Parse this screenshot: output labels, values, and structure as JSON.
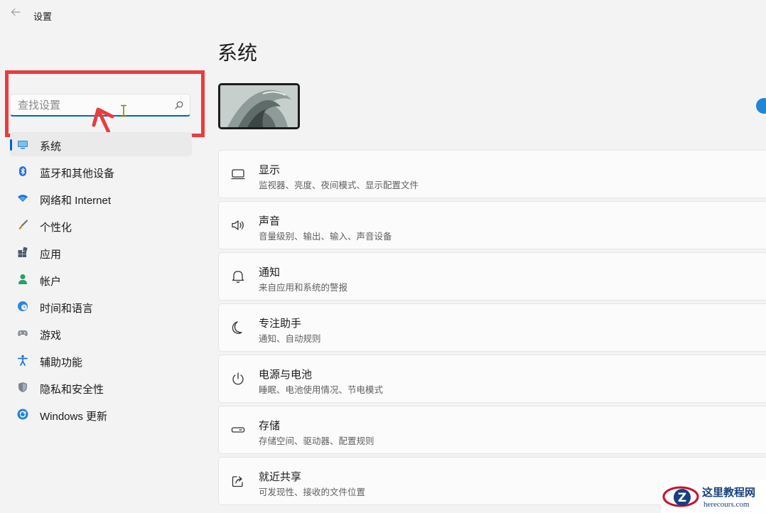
{
  "window": {
    "back_icon": "back-arrow-icon",
    "title": "设置"
  },
  "search": {
    "placeholder": "查找设置",
    "value": "",
    "icon": "search-icon",
    "annotation_color": "#ea3b3e"
  },
  "sidebar": {
    "items": [
      {
        "label": "系统",
        "icon": "monitor-icon",
        "active": true
      },
      {
        "label": "蓝牙和其他设备",
        "icon": "bluetooth-icon"
      },
      {
        "label": "网络和 Internet",
        "icon": "wifi-icon"
      },
      {
        "label": "个性化",
        "icon": "brush-icon"
      },
      {
        "label": "应用",
        "icon": "apps-icon"
      },
      {
        "label": "帐户",
        "icon": "account-icon"
      },
      {
        "label": "时间和语言",
        "icon": "globe-clock-icon"
      },
      {
        "label": "游戏",
        "icon": "gamepad-icon"
      },
      {
        "label": "辅助功能",
        "icon": "accessibility-icon"
      },
      {
        "label": "隐私和安全性",
        "icon": "shield-icon"
      },
      {
        "label": "Windows 更新",
        "icon": "windows-update-icon"
      }
    ]
  },
  "main": {
    "title": "系统",
    "cards": [
      {
        "title": "显示",
        "description": "监视器、亮度、夜间模式、显示配置文件",
        "icon": "display-icon"
      },
      {
        "title": "声音",
        "description": "音量级别、输出、输入、声音设备",
        "icon": "speaker-icon"
      },
      {
        "title": "通知",
        "description": "来自应用和系统的警报",
        "icon": "bell-icon"
      },
      {
        "title": "专注助手",
        "description": "通知、自动规则",
        "icon": "moon-icon"
      },
      {
        "title": "电源与电池",
        "description": "睡眠、电池使用情况、节电模式",
        "icon": "power-icon"
      },
      {
        "title": "存储",
        "description": "存储空间、驱动器、配置规则",
        "icon": "storage-drive-icon"
      },
      {
        "title": "就近共享",
        "description": "可发现性、接收的文件位置",
        "icon": "share-icon"
      }
    ]
  },
  "watermark": {
    "logo_letter": "Z",
    "name": "这里教程网",
    "url": "herecours.com"
  },
  "colors": {
    "accent": "#0067c0",
    "annotation_red": "#ea3b3e",
    "background": "#f3f3f3",
    "card": "#fbfbfb"
  }
}
